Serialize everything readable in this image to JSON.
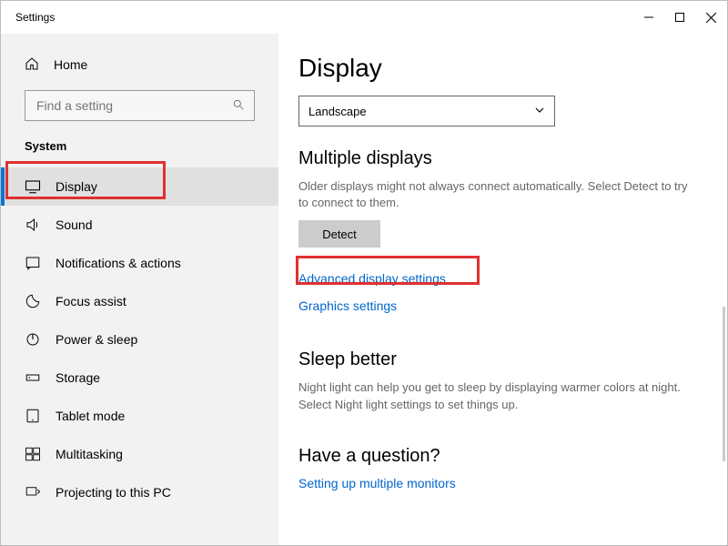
{
  "window": {
    "title": "Settings"
  },
  "home": {
    "label": "Home"
  },
  "search": {
    "placeholder": "Find a setting"
  },
  "section": {
    "label": "System"
  },
  "side_items": [
    {
      "name": "display",
      "label": "Display"
    },
    {
      "name": "sound",
      "label": "Sound"
    },
    {
      "name": "notifications",
      "label": "Notifications & actions"
    },
    {
      "name": "focus",
      "label": "Focus assist"
    },
    {
      "name": "power",
      "label": "Power & sleep"
    },
    {
      "name": "storage",
      "label": "Storage"
    },
    {
      "name": "tablet",
      "label": "Tablet mode"
    },
    {
      "name": "multitask",
      "label": "Multitasking"
    },
    {
      "name": "projecting",
      "label": "Projecting to this PC"
    }
  ],
  "main": {
    "title": "Display",
    "orientation": {
      "selected": "Landscape"
    },
    "multiple": {
      "heading": "Multiple displays",
      "desc": "Older displays might not always connect automatically. Select Detect to try to connect to them.",
      "detect": "Detect"
    },
    "adv_link": "Advanced display settings",
    "gfx_link": "Graphics settings",
    "sleep": {
      "heading": "Sleep better",
      "desc": "Night light can help you get to sleep by displaying warmer colors at night. Select Night light settings to set things up."
    },
    "question": {
      "heading": "Have a question?",
      "link": "Setting up multiple monitors"
    }
  }
}
